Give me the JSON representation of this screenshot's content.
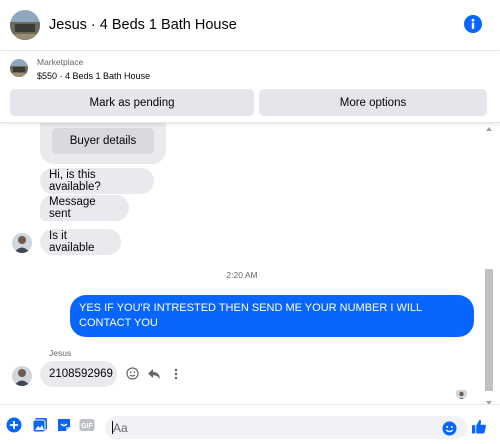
{
  "header": {
    "title": "Jesus · 4 Beds 1 Bath House",
    "info_icon": "info-icon"
  },
  "marketplace": {
    "label": "Marketplace",
    "listing": "$550 · 4 Beds 1 Bath House",
    "mark_pending_label": "Mark as pending",
    "more_options_label": "More options"
  },
  "messages": {
    "buyer_details_label": "Buyer details",
    "m1": "Hi, is this available?",
    "m2": "Message sent",
    "m3": "Is it available",
    "timestamp": "2:20 AM",
    "outgoing": "YES IF YOU'R INTRESTED THEN SEND ME YOUR NUMBER I WILL CONTACT YOU",
    "sender_name": "Jesus",
    "m4": "2108592969"
  },
  "composer": {
    "placeholder": "Aa",
    "value": ""
  },
  "colors": {
    "accent": "#0866ff",
    "incoming_bubble": "#e9eaed",
    "button_bg": "#e4e6eb",
    "secondary_text": "#65676b"
  }
}
